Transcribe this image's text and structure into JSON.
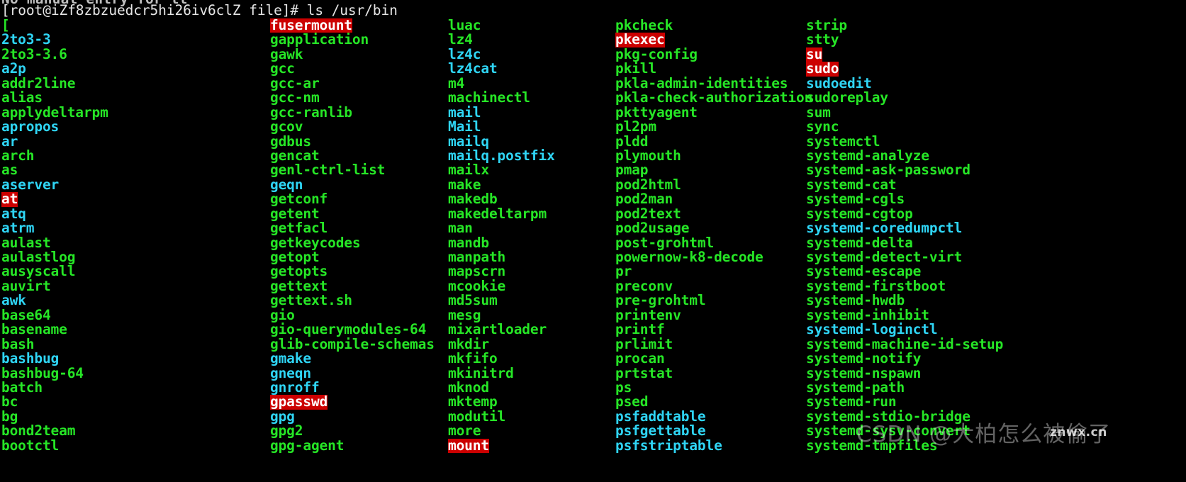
{
  "terminal": {
    "background_color": "#000000",
    "exec_color": "#26e626",
    "link_color": "#2fd5f5",
    "setuid_bg_color": "#cc0000",
    "setuid_fg_color": "#ffffff",
    "prompt_color": "#e6e6e6",
    "scrollback_line": "No manual entry for tt",
    "prompt": "[root@iZf8zbzuedcr5hi26iv6clZ file]# ls /usr/bin"
  },
  "watermarks": {
    "csdn": "CSDN @大柏怎么被偷了",
    "znwx": "znwx.cn"
  },
  "ls_output": {
    "columns": [
      {
        "index": 0,
        "entries": [
          {
            "name": "[",
            "type": "exec"
          },
          {
            "name": "2to3-3",
            "type": "link"
          },
          {
            "name": "2to3-3.6",
            "type": "exec"
          },
          {
            "name": "a2p",
            "type": "link"
          },
          {
            "name": "addr2line",
            "type": "exec"
          },
          {
            "name": "alias",
            "type": "exec"
          },
          {
            "name": "applydeltarpm",
            "type": "exec"
          },
          {
            "name": "apropos",
            "type": "link"
          },
          {
            "name": "ar",
            "type": "link"
          },
          {
            "name": "arch",
            "type": "exec"
          },
          {
            "name": "as",
            "type": "exec"
          },
          {
            "name": "aserver",
            "type": "link"
          },
          {
            "name": "at",
            "type": "setuid"
          },
          {
            "name": "atq",
            "type": "link"
          },
          {
            "name": "atrm",
            "type": "link"
          },
          {
            "name": "aulast",
            "type": "exec"
          },
          {
            "name": "aulastlog",
            "type": "exec"
          },
          {
            "name": "ausyscall",
            "type": "exec"
          },
          {
            "name": "auvirt",
            "type": "exec"
          },
          {
            "name": "awk",
            "type": "link"
          },
          {
            "name": "base64",
            "type": "exec"
          },
          {
            "name": "basename",
            "type": "exec"
          },
          {
            "name": "bash",
            "type": "exec"
          },
          {
            "name": "bashbug",
            "type": "link"
          },
          {
            "name": "bashbug-64",
            "type": "exec"
          },
          {
            "name": "batch",
            "type": "exec"
          },
          {
            "name": "bc",
            "type": "exec"
          },
          {
            "name": "bg",
            "type": "exec"
          },
          {
            "name": "bond2team",
            "type": "exec"
          },
          {
            "name": "bootctl",
            "type": "exec"
          }
        ]
      },
      {
        "index": 1,
        "entries": [
          {
            "name": "fusermount",
            "type": "setuid"
          },
          {
            "name": "gapplication",
            "type": "exec"
          },
          {
            "name": "gawk",
            "type": "exec"
          },
          {
            "name": "gcc",
            "type": "exec"
          },
          {
            "name": "gcc-ar",
            "type": "exec"
          },
          {
            "name": "gcc-nm",
            "type": "exec"
          },
          {
            "name": "gcc-ranlib",
            "type": "exec"
          },
          {
            "name": "gcov",
            "type": "exec"
          },
          {
            "name": "gdbus",
            "type": "exec"
          },
          {
            "name": "gencat",
            "type": "exec"
          },
          {
            "name": "genl-ctrl-list",
            "type": "exec"
          },
          {
            "name": "geqn",
            "type": "link"
          },
          {
            "name": "getconf",
            "type": "exec"
          },
          {
            "name": "getent",
            "type": "exec"
          },
          {
            "name": "getfacl",
            "type": "exec"
          },
          {
            "name": "getkeycodes",
            "type": "exec"
          },
          {
            "name": "getopt",
            "type": "exec"
          },
          {
            "name": "getopts",
            "type": "exec"
          },
          {
            "name": "gettext",
            "type": "exec"
          },
          {
            "name": "gettext.sh",
            "type": "exec"
          },
          {
            "name": "gio",
            "type": "exec"
          },
          {
            "name": "gio-querymodules-64",
            "type": "exec"
          },
          {
            "name": "glib-compile-schemas",
            "type": "exec"
          },
          {
            "name": "gmake",
            "type": "link"
          },
          {
            "name": "gneqn",
            "type": "link"
          },
          {
            "name": "gnroff",
            "type": "link"
          },
          {
            "name": "gpasswd",
            "type": "setuid"
          },
          {
            "name": "gpg",
            "type": "link"
          },
          {
            "name": "gpg2",
            "type": "exec"
          },
          {
            "name": "gpg-agent",
            "type": "exec"
          }
        ]
      },
      {
        "index": 2,
        "entries": [
          {
            "name": "luac",
            "type": "exec"
          },
          {
            "name": "lz4",
            "type": "exec"
          },
          {
            "name": "lz4c",
            "type": "link"
          },
          {
            "name": "lz4cat",
            "type": "link"
          },
          {
            "name": "m4",
            "type": "exec"
          },
          {
            "name": "machinectl",
            "type": "exec"
          },
          {
            "name": "mail",
            "type": "link"
          },
          {
            "name": "Mail",
            "type": "link"
          },
          {
            "name": "mailq",
            "type": "link"
          },
          {
            "name": "mailq.postfix",
            "type": "link"
          },
          {
            "name": "mailx",
            "type": "exec"
          },
          {
            "name": "make",
            "type": "exec"
          },
          {
            "name": "makedb",
            "type": "exec"
          },
          {
            "name": "makedeltarpm",
            "type": "exec"
          },
          {
            "name": "man",
            "type": "exec"
          },
          {
            "name": "mandb",
            "type": "exec"
          },
          {
            "name": "manpath",
            "type": "exec"
          },
          {
            "name": "mapscrn",
            "type": "exec"
          },
          {
            "name": "mcookie",
            "type": "exec"
          },
          {
            "name": "md5sum",
            "type": "exec"
          },
          {
            "name": "mesg",
            "type": "exec"
          },
          {
            "name": "mixartloader",
            "type": "exec"
          },
          {
            "name": "mkdir",
            "type": "exec"
          },
          {
            "name": "mkfifo",
            "type": "exec"
          },
          {
            "name": "mkinitrd",
            "type": "exec"
          },
          {
            "name": "mknod",
            "type": "exec"
          },
          {
            "name": "mktemp",
            "type": "exec"
          },
          {
            "name": "modutil",
            "type": "exec"
          },
          {
            "name": "more",
            "type": "exec"
          },
          {
            "name": "mount",
            "type": "setuid"
          }
        ]
      },
      {
        "index": 3,
        "entries": [
          {
            "name": "pkcheck",
            "type": "exec"
          },
          {
            "name": "pkexec",
            "type": "setuid"
          },
          {
            "name": "pkg-config",
            "type": "exec"
          },
          {
            "name": "pkill",
            "type": "exec"
          },
          {
            "name": "pkla-admin-identities",
            "type": "exec"
          },
          {
            "name": "pkla-check-authorization",
            "type": "exec"
          },
          {
            "name": "pkttyagent",
            "type": "exec"
          },
          {
            "name": "pl2pm",
            "type": "exec"
          },
          {
            "name": "pldd",
            "type": "exec"
          },
          {
            "name": "plymouth",
            "type": "exec"
          },
          {
            "name": "pmap",
            "type": "exec"
          },
          {
            "name": "pod2html",
            "type": "exec"
          },
          {
            "name": "pod2man",
            "type": "exec"
          },
          {
            "name": "pod2text",
            "type": "exec"
          },
          {
            "name": "pod2usage",
            "type": "exec"
          },
          {
            "name": "post-grohtml",
            "type": "exec"
          },
          {
            "name": "powernow-k8-decode",
            "type": "exec"
          },
          {
            "name": "pr",
            "type": "exec"
          },
          {
            "name": "preconv",
            "type": "exec"
          },
          {
            "name": "pre-grohtml",
            "type": "exec"
          },
          {
            "name": "printenv",
            "type": "exec"
          },
          {
            "name": "printf",
            "type": "exec"
          },
          {
            "name": "prlimit",
            "type": "exec"
          },
          {
            "name": "procan",
            "type": "exec"
          },
          {
            "name": "prtstat",
            "type": "exec"
          },
          {
            "name": "ps",
            "type": "exec"
          },
          {
            "name": "psed",
            "type": "exec"
          },
          {
            "name": "psfaddtable",
            "type": "link"
          },
          {
            "name": "psfgettable",
            "type": "link"
          },
          {
            "name": "psfstriptable",
            "type": "link"
          }
        ]
      },
      {
        "index": 4,
        "entries": [
          {
            "name": "strip",
            "type": "exec"
          },
          {
            "name": "stty",
            "type": "exec"
          },
          {
            "name": "su",
            "type": "setuid"
          },
          {
            "name": "sudo",
            "type": "setuid"
          },
          {
            "name": "sudoedit",
            "type": "link"
          },
          {
            "name": "sudoreplay",
            "type": "exec"
          },
          {
            "name": "sum",
            "type": "exec"
          },
          {
            "name": "sync",
            "type": "exec"
          },
          {
            "name": "systemctl",
            "type": "exec"
          },
          {
            "name": "systemd-analyze",
            "type": "exec"
          },
          {
            "name": "systemd-ask-password",
            "type": "exec"
          },
          {
            "name": "systemd-cat",
            "type": "exec"
          },
          {
            "name": "systemd-cgls",
            "type": "exec"
          },
          {
            "name": "systemd-cgtop",
            "type": "exec"
          },
          {
            "name": "systemd-coredumpctl",
            "type": "link"
          },
          {
            "name": "systemd-delta",
            "type": "exec"
          },
          {
            "name": "systemd-detect-virt",
            "type": "exec"
          },
          {
            "name": "systemd-escape",
            "type": "exec"
          },
          {
            "name": "systemd-firstboot",
            "type": "exec"
          },
          {
            "name": "systemd-hwdb",
            "type": "exec"
          },
          {
            "name": "systemd-inhibit",
            "type": "exec"
          },
          {
            "name": "systemd-loginctl",
            "type": "link"
          },
          {
            "name": "systemd-machine-id-setup",
            "type": "exec"
          },
          {
            "name": "systemd-notify",
            "type": "exec"
          },
          {
            "name": "systemd-nspawn",
            "type": "exec"
          },
          {
            "name": "systemd-path",
            "type": "exec"
          },
          {
            "name": "systemd-run",
            "type": "exec"
          },
          {
            "name": "systemd-stdio-bridge",
            "type": "exec"
          },
          {
            "name": "systemd-sysv-convert",
            "type": "exec"
          },
          {
            "name": "systemd-tmpfiles",
            "type": "exec"
          }
        ]
      }
    ]
  }
}
